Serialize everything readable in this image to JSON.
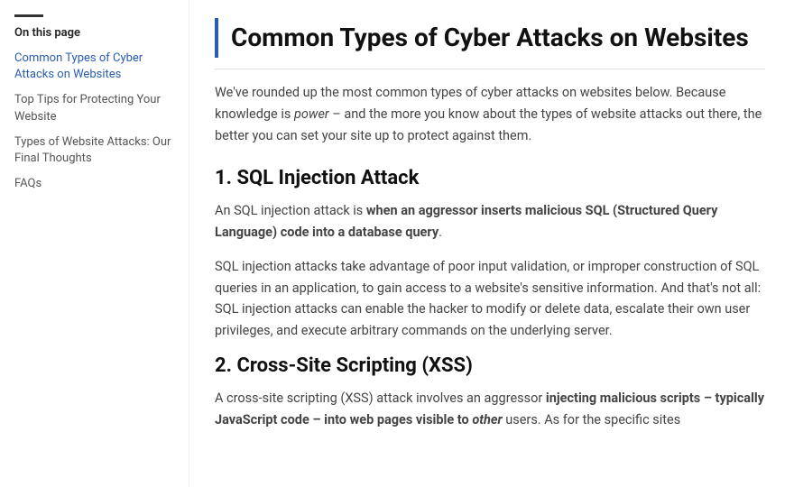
{
  "sidebar": {
    "label": "On this page",
    "items": [
      {
        "id": "common-types",
        "text": "Common Types of Cyber Attacks on Websites",
        "active": true
      },
      {
        "id": "top-tips",
        "text": "Top Tips for Protecting Your Website",
        "active": false
      },
      {
        "id": "final-thoughts",
        "text": "Types of Website Attacks: Our Final Thoughts",
        "active": false
      },
      {
        "id": "faqs",
        "text": "FAQs",
        "active": false
      }
    ]
  },
  "main": {
    "title": "Common Types of Cyber Attacks on Websites",
    "intro": "We've rounded up the most common types of cyber attacks on websites below. Because knowledge is power – and the more you know about the types of website attacks out there, the better you can set your site up to protect against them.",
    "intro_italic_word": "power",
    "section1": {
      "title": "1. SQL Injection Attack",
      "para1_plain_start": "An SQL injection attack is ",
      "para1_bold": "when an aggressor inserts malicious SQL (Structured Query Language) code into a database query",
      "para1_plain_end": ".",
      "para2": "SQL injection attacks take advantage of poor input validation, or improper construction of SQL queries in an application, to gain access to a website's sensitive information. And that's not all: SQL injection attacks can enable the hacker to modify or delete data, escalate their own user privileges, and execute arbitrary commands on the underlying server."
    },
    "section2": {
      "title": "2. Cross-Site Scripting (XSS)",
      "para1_plain_start": "A cross-site scripting (XSS) attack involves an aggressor ",
      "para1_bold": "injecting malicious scripts – typically JavaScript code – into web pages visible to ",
      "para1_italic": "other",
      "para1_plain_end": " users. As for the specific sites"
    }
  }
}
